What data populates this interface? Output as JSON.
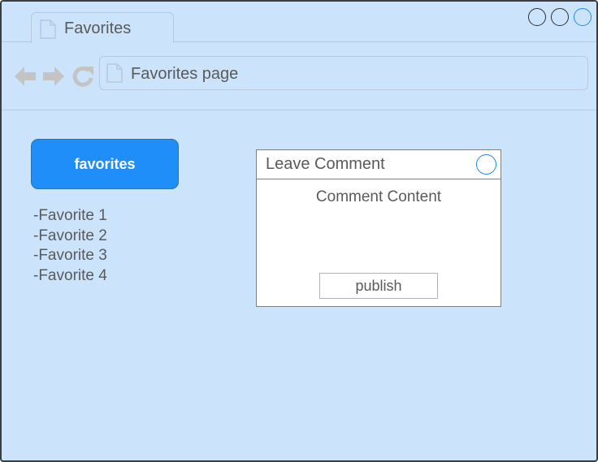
{
  "window": {
    "tab_title": "Favorites",
    "address": "Favorites page",
    "controls": [
      "minimize",
      "maximize",
      "close"
    ]
  },
  "toolbar": {
    "back_icon": "arrow-left-icon",
    "forward_icon": "arrow-right-icon",
    "reload_icon": "reload-icon"
  },
  "sidebar": {
    "button_label": "favorites",
    "items": [
      "-Favorite 1",
      "-Favorite 2",
      "-Favorite 3",
      "-Favorite 4"
    ]
  },
  "dialog": {
    "title": "Leave Comment",
    "content_label": "Comment Content",
    "publish_label": "publish"
  },
  "colors": {
    "background": "#cce4fb",
    "accent": "#1f8ef8",
    "border": "#b6c8da"
  }
}
